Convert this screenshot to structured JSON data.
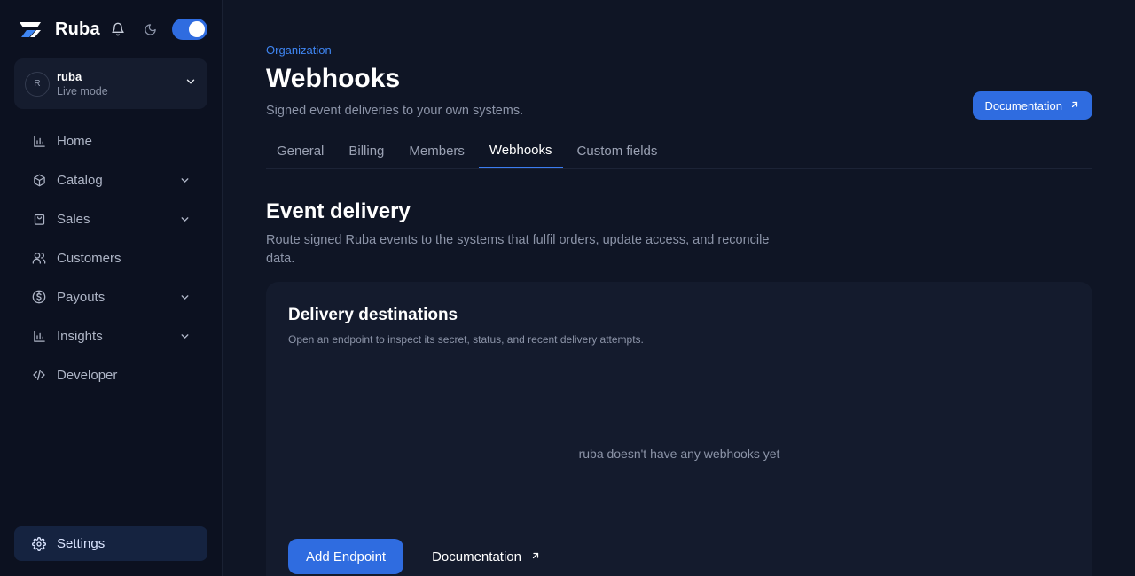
{
  "brand": {
    "name": "Ruba"
  },
  "org": {
    "avatar_letter": "R",
    "name": "ruba",
    "mode": "Live mode"
  },
  "nav": {
    "items": [
      {
        "label": "Home"
      },
      {
        "label": "Catalog"
      },
      {
        "label": "Sales"
      },
      {
        "label": "Customers"
      },
      {
        "label": "Payouts"
      },
      {
        "label": "Insights"
      },
      {
        "label": "Developer"
      }
    ],
    "settings": "Settings"
  },
  "header": {
    "breadcrumb": "Organization",
    "title": "Webhooks",
    "subtitle": "Signed event deliveries to your own systems.",
    "doc_button": "Documentation"
  },
  "tabs": [
    {
      "label": "General"
    },
    {
      "label": "Billing"
    },
    {
      "label": "Members"
    },
    {
      "label": "Webhooks"
    },
    {
      "label": "Custom fields"
    }
  ],
  "section": {
    "title": "Event delivery",
    "description": "Route signed Ruba events to the systems that fulfil orders, update access, and reconcile data."
  },
  "card": {
    "title": "Delivery destinations",
    "description": "Open an endpoint to inspect its secret, status, and recent delivery attempts.",
    "empty_state": "ruba doesn't have any webhooks yet",
    "add_button": "Add Endpoint",
    "doc_link": "Documentation"
  },
  "colors": {
    "accent": "#2f6ce0",
    "background": "#0f1525",
    "sidebar": "#0c1120",
    "card": "#141b2d"
  }
}
